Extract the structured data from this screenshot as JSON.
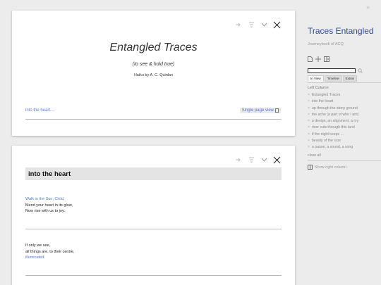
{
  "tiddler1": {
    "title": "Entangled Traces",
    "subtitle": "(to see & hold true)",
    "byline": "Haiku by A. C. Quinlan",
    "next_link": "into the heart....",
    "single_page_view": "Single page view"
  },
  "tiddler2": {
    "heading": "into the heart",
    "stanza1": {
      "line1": "Walk in the Sun, Child,",
      "line2": "Mend your heart in its glow,",
      "line3": "Now rise with us to joy."
    },
    "stanza2": {
      "line1": "If only we see,",
      "line2": "all things are, to their centre,",
      "line3": "illuminated."
    }
  },
  "sidebar": {
    "collapse_glyph": "»",
    "title": "Traces Entangled",
    "subtitle": "Journeybook of ACQ",
    "tabs": [
      "In View",
      "Timeline",
      "Extras"
    ],
    "section_label": "Left Column",
    "items": [
      "Entangled Traces",
      "into the heart",
      "up through the stony ground",
      "the ache (a part of who I am)",
      "a design, an alignment, a cry",
      "river cuts through this land",
      "if the night keeps ...",
      "beauty of the scar",
      "a pause, a sound, a song"
    ],
    "close_all": "close all",
    "show_right_column": "Show right column"
  },
  "colors": {
    "accent": "#5778d8",
    "title_blue": "#2e4a8c"
  }
}
